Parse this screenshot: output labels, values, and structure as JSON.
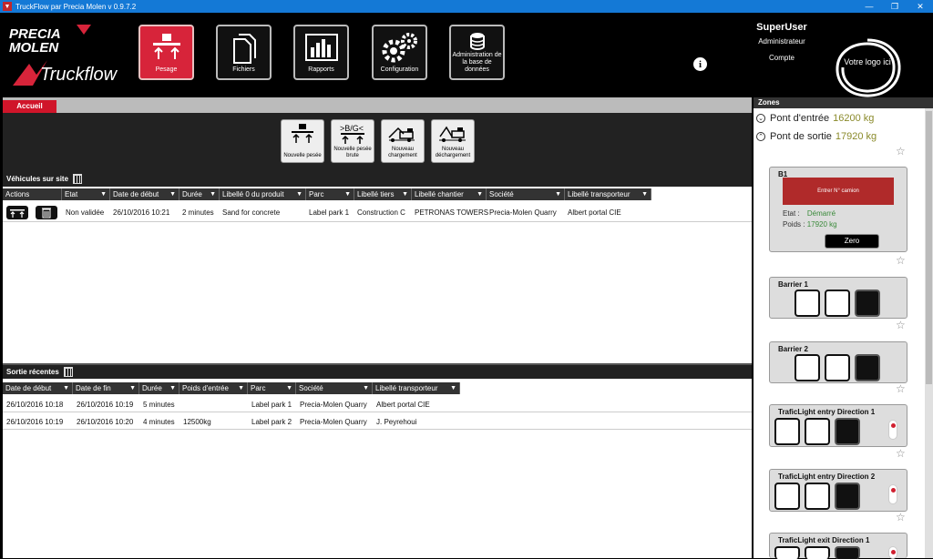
{
  "window": {
    "title": "TruckFlow par Precia Molen v 0.9.7.2",
    "controls": [
      "minimize",
      "maximize",
      "close"
    ]
  },
  "brand": {
    "name": "PRECIA MOLEN",
    "product": "Truckflow",
    "accent": "#d7243a"
  },
  "nav": [
    {
      "label": "Pesage",
      "icon": "scale-icon",
      "active": true
    },
    {
      "label": "Fichiers",
      "icon": "files-icon",
      "active": false
    },
    {
      "label": "Rapports",
      "icon": "bar-chart-icon",
      "active": false
    },
    {
      "label": "Configuration",
      "icon": "gears-icon",
      "active": false
    },
    {
      "label": "Administration de la base de données",
      "icon": "database-icon",
      "active": false
    }
  ],
  "user": {
    "name": "SuperUser",
    "role": "Administrateur",
    "account": "Compte"
  },
  "customer_logo": {
    "text": "Votre logo ici"
  },
  "tabs": [
    {
      "label": "Accueil"
    }
  ],
  "actions": [
    {
      "label": "Nouvelle pesée",
      "icon": "weighing-icon"
    },
    {
      "label": "Nouvelle pesée brute",
      "icon": "gross-weighing-icon"
    },
    {
      "label": "Nouveau chargement",
      "icon": "loading-truck-icon"
    },
    {
      "label": "Nouveau déchargement",
      "icon": "unloading-truck-icon"
    }
  ],
  "vehicles": {
    "title": "Véhicules sur site",
    "columns": [
      "Actions",
      "Etat",
      "Date de début",
      "Durée",
      "Libellé 0 du produit",
      "Parc",
      "Libellé tiers",
      "Libellé chantier",
      "Société",
      "Libellé transporteur"
    ],
    "rows": [
      {
        "etat": "Non validée",
        "debut": "26/10/2016 10:21",
        "duree": "2 minutes",
        "produit": "Sand for concrete",
        "parc": "Label park 1",
        "tiers": "Construction C",
        "chantier": "PETRONAS TOWERS",
        "societe": "Precia-Molen Quarry",
        "transporteur": "Albert portal CIE"
      }
    ]
  },
  "recent": {
    "title": "Sortie récentes",
    "columns": [
      "Date de début",
      "Date de fin",
      "Durée",
      "Poids d'entrée",
      "Parc",
      "Société",
      "Libellé transporteur"
    ],
    "rows": [
      {
        "debut": "26/10/2016 10:18",
        "fin": "26/10/2016 10:19",
        "duree": "5 minutes",
        "poids": "",
        "parc": "Label park 1",
        "societe": "Precia-Molen Quarry",
        "transporteur": "Albert portal CIE"
      },
      {
        "debut": "26/10/2016 10:19",
        "fin": "26/10/2016 10:20",
        "duree": "4 minutes",
        "poids": "12500kg",
        "parc": "Label park 2",
        "societe": "Precia-Molen Quarry",
        "transporteur": "J. Peyrehoui"
      }
    ]
  },
  "zones": {
    "title": "Zones",
    "items": [
      {
        "name": "Pont d'entrée",
        "weight": "16200 kg",
        "expanded": false
      },
      {
        "name": "Pont de sortie",
        "weight": "17920 kg",
        "expanded": true
      }
    ],
    "scale": {
      "name": "B1",
      "display": "Entrer N° camion",
      "etat_label": "Etat",
      "etat_value": "Démarré",
      "poids_label": "Poids",
      "poids_value": "17920 kg",
      "zero_label": "Zero"
    },
    "devices": [
      {
        "name": "Barrier 1",
        "type": "barrier"
      },
      {
        "name": "Barrier 2",
        "type": "barrier"
      },
      {
        "name": "TraficLight entry Direction 1",
        "type": "light"
      },
      {
        "name": "TraficLight entry Direction 2",
        "type": "light"
      },
      {
        "name": "TraficLight exit Direction 1",
        "type": "light"
      }
    ]
  }
}
